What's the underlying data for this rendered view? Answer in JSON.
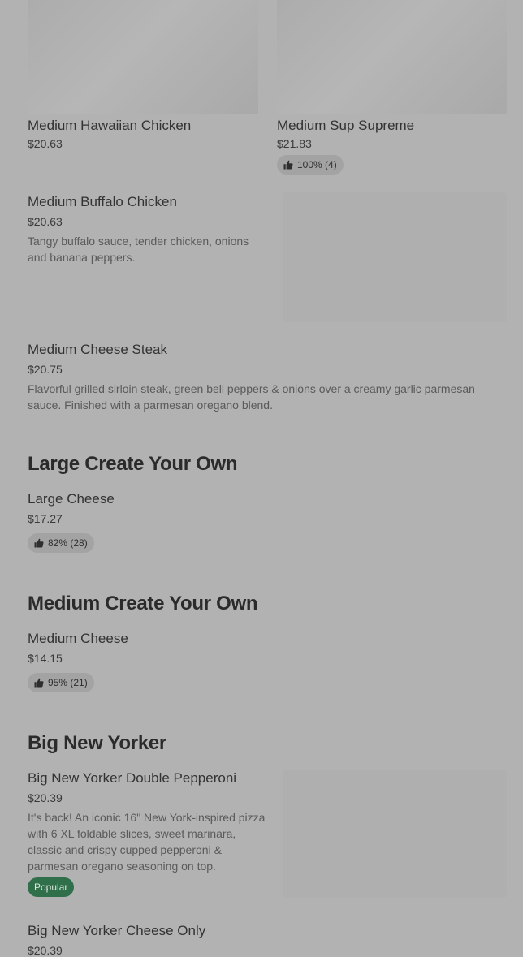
{
  "items": {
    "hawaiian": {
      "name": "Medium Hawaiian Chicken",
      "price": "$20.63"
    },
    "supreme": {
      "name": "Medium Sup Supreme",
      "price": "$21.83",
      "rating": "100% (4)"
    },
    "buffalo": {
      "name": "Medium Buffalo Chicken",
      "price": "$20.63",
      "description": "Tangy buffalo sauce, tender chicken, onions and banana peppers."
    },
    "cheese_steak": {
      "name": "Medium Cheese Steak",
      "price": "$20.75",
      "description": "Flavorful grilled sirloin steak, green bell peppers & onions over a creamy garlic parmesan sauce. Finished with a parmesan oregano blend."
    },
    "large_cheese": {
      "name": "Large Cheese",
      "price": "$17.27",
      "rating": "82% (28)"
    },
    "medium_cheese": {
      "name": "Medium Cheese",
      "price": "$14.15",
      "rating": "95% (21)"
    },
    "bny_pepperoni": {
      "name": "Big New Yorker Double Pepperoni",
      "price": "$20.39",
      "description": "It's back! An iconic 16\" New York-inspired pizza with 6 XL foldable slices, sweet marinara, classic and crispy cupped pepperoni & parmesan oregano seasoning on top.",
      "badge": "Popular"
    },
    "bny_cheese": {
      "name": "Big New Yorker Cheese Only",
      "price": "$20.39"
    }
  },
  "sections": {
    "large_cyo": "Large Create Your Own",
    "medium_cyo": "Medium Create Your Own",
    "big_new_yorker": "Big New Yorker"
  },
  "icons": {
    "rating": "thumbs-up-icon"
  },
  "colors": {
    "overlay_bg": "#b2b2b2",
    "popular_badge": "#2f6f4a",
    "rating_pill": "#a3a3a3"
  }
}
